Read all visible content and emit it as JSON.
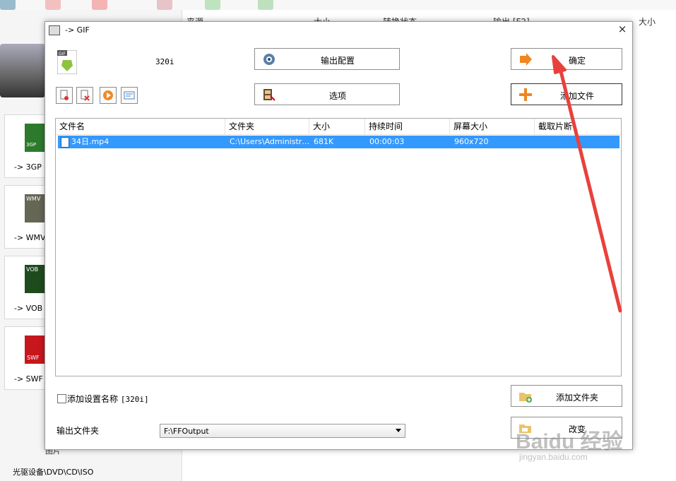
{
  "background": {
    "list_headers": [
      "来源",
      "大小",
      "转换状态",
      "输出 [F2]",
      "大小"
    ],
    "categories": [
      "-> 3GP",
      "-> WMV",
      "-> VOB",
      "-> SWF"
    ],
    "category_badges": [
      "3GP",
      "WMV",
      "VOB",
      "SWF"
    ],
    "footer_text": "光驱设备\\DVD\\CD\\ISO",
    "partial_text": "图片"
  },
  "dialog": {
    "title": "-> GIF",
    "close_glyph": "×",
    "format_badge": "GIF",
    "preset": "320i",
    "buttons": {
      "output_config": "输出配置",
      "options": "选项",
      "ok": "确定",
      "add_file": "添加文件",
      "add_folder": "添加文件夹",
      "change": "改变"
    },
    "file_list": {
      "columns": [
        "文件名",
        "文件夹",
        "大小",
        "持续时间",
        "屏幕大小",
        "截取片断"
      ],
      "rows": [
        {
          "name": "34日.mp4",
          "folder": "C:\\Users\\Administr…",
          "size": "681K",
          "duration": "00:00:03",
          "screen": "960x720",
          "clip": ""
        }
      ]
    },
    "add_setting_name_label": "添加设置名称",
    "add_setting_name_value": "[320i]",
    "output_folder_label": "输出文件夹",
    "output_folder_value": "F:\\FFOutput"
  },
  "watermark": {
    "main": "Baidu 经验",
    "sub": "jingyan.baidu.com"
  },
  "colors": {
    "selection": "#3399ff",
    "annotation_arrow": "#e8413c",
    "ok_icon": "#f0861f",
    "add_icon": "#f0861f"
  }
}
